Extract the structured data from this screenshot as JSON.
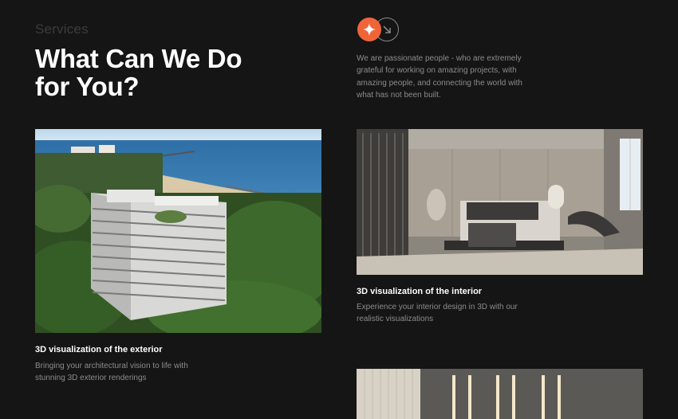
{
  "header": {
    "eyebrow": "Services",
    "title": "What Can We Do for You?",
    "intro": "We are passionate people - who are extremely grateful for working on amazing projects, with amazing people, and connecting the world with what has not been built.",
    "accent_color": "#f0643a",
    "icons": [
      "sparkle-icon",
      "arrow-down-right-icon"
    ]
  },
  "services": [
    {
      "title": "3D visualization of the exterior",
      "description": "Bringing your architectural vision to life with stunning 3D exterior renderings"
    },
    {
      "title": "3D visualization of the interior",
      "description": "Experience your interior design in 3D with our realistic visualizations"
    }
  ]
}
